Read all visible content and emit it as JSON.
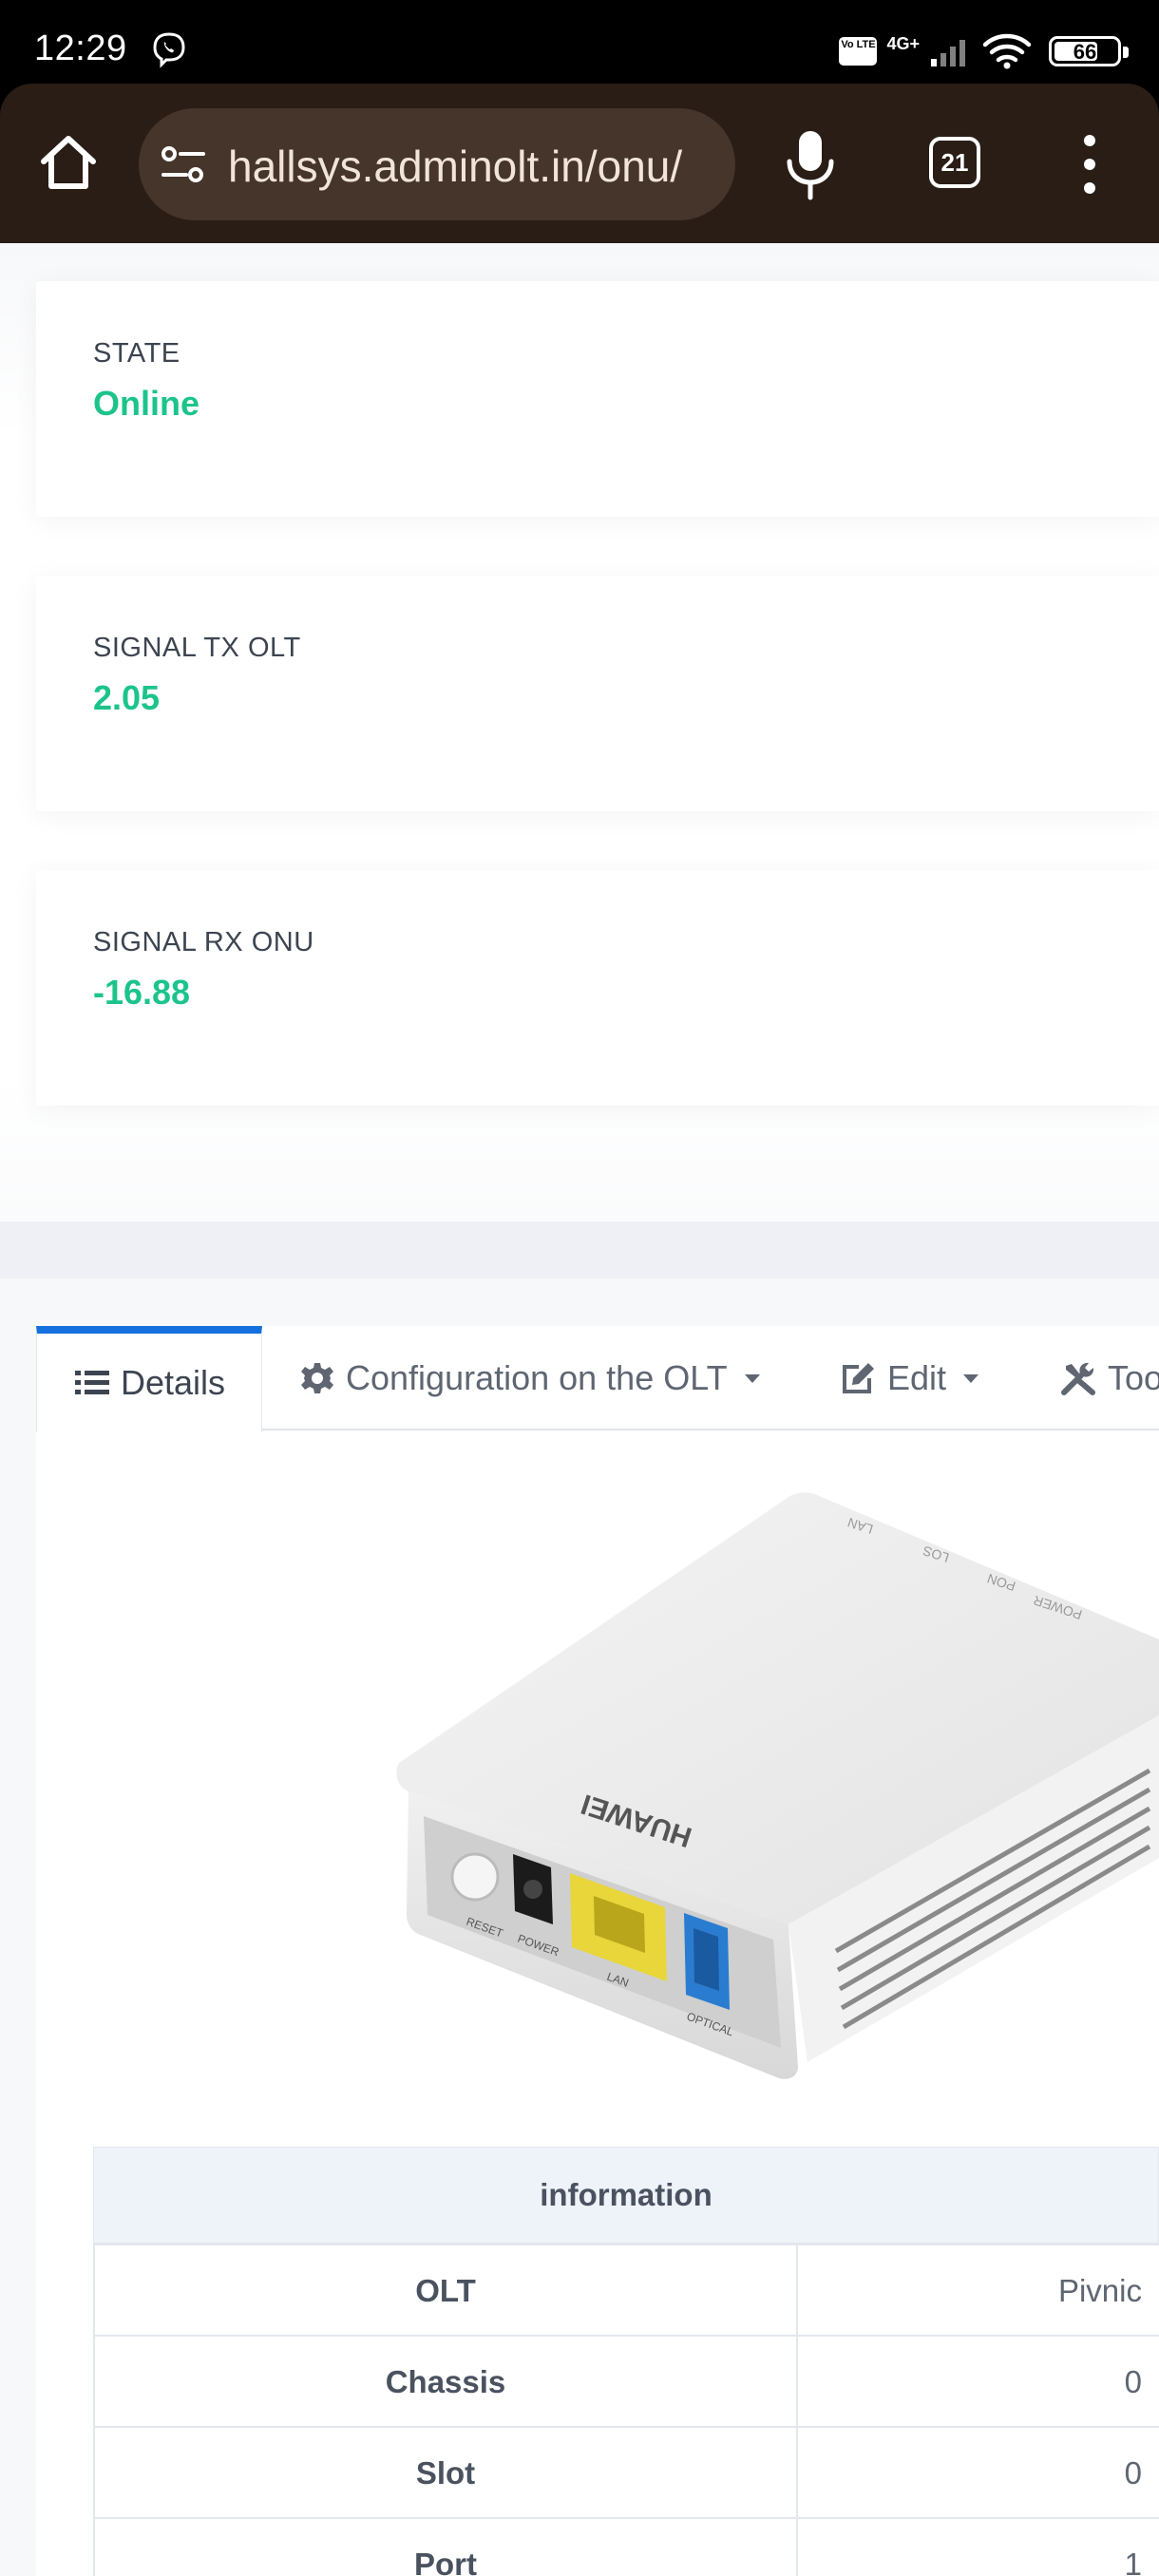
{
  "status_bar": {
    "time": "12:29",
    "volte_label": "Vo LTE",
    "network_label": "4G+",
    "battery_percent": "66"
  },
  "browser": {
    "url": "hallsys.adminolt.in/onu/",
    "tab_count": "21"
  },
  "stats": [
    {
      "label": "STATE",
      "value": "Online"
    },
    {
      "label": "SIGNAL TX OLT",
      "value": "2.05"
    },
    {
      "label": "SIGNAL RX ONU",
      "value": "-16.88"
    }
  ],
  "tabs": [
    {
      "label": "Details"
    },
    {
      "label": "Configuration on the OLT"
    },
    {
      "label": "Edit"
    },
    {
      "label": "Tools"
    }
  ],
  "device": {
    "brand": "HUAWEI",
    "led_labels": [
      "POWER",
      "PON",
      "LOS",
      "LAN"
    ],
    "port_labels": [
      "RESET",
      "POWER",
      "LAN",
      "OPTICAL"
    ]
  },
  "info": {
    "header": "information",
    "rows": [
      {
        "key": "OLT",
        "value": "Pivnic"
      },
      {
        "key": "Chassis",
        "value": "0"
      },
      {
        "key": "Slot",
        "value": "0"
      },
      {
        "key": "Port",
        "value": "1"
      }
    ]
  },
  "colors": {
    "accent_green": "#1cc48a",
    "tab_active_blue": "#1570dd",
    "toolbar_brown": "#2a1d15"
  }
}
